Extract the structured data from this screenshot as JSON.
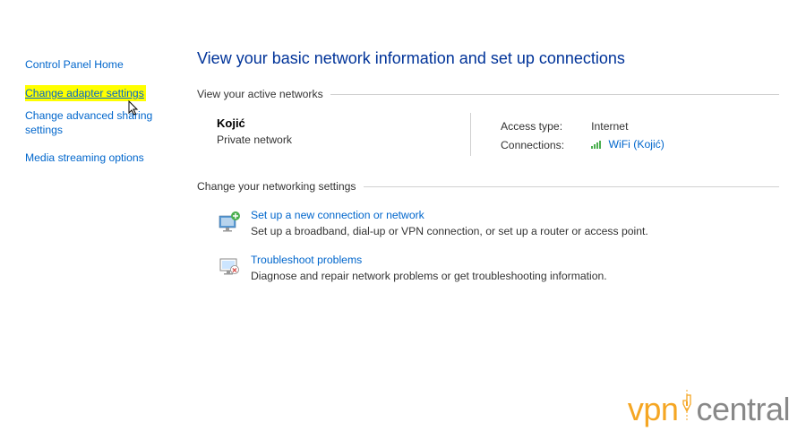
{
  "sidebar": {
    "home": "Control Panel Home",
    "adapter": "Change adapter settings",
    "advanced": "Change advanced sharing settings",
    "media": "Media streaming options"
  },
  "main": {
    "title": "View your basic network information and set up connections",
    "active_header": "View your active networks",
    "network": {
      "name": "Kojić",
      "type": "Private network",
      "access_label": "Access type:",
      "access_value": "Internet",
      "conn_label": "Connections:",
      "conn_value": "WiFi (Kojić)"
    },
    "settings_header": "Change your networking settings",
    "setup": {
      "link": "Set up a new connection or network",
      "desc": "Set up a broadband, dial-up or VPN connection, or set up a router or access point."
    },
    "troubleshoot": {
      "link": "Troubleshoot problems",
      "desc": "Diagnose and repair network problems or get troubleshooting information."
    }
  },
  "logo": {
    "part1": "vpn",
    "part2": "central"
  }
}
